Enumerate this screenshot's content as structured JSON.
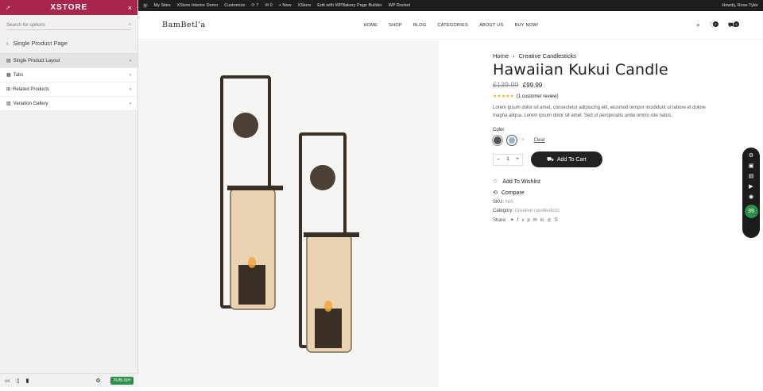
{
  "customizer": {
    "logo": "XSTORE",
    "close": "×",
    "search_placeholder": "Search for options",
    "section_title": "Single Product Page",
    "items": [
      {
        "label": "Single Product Layout",
        "icon": "layout-icon"
      },
      {
        "label": "Tabs",
        "icon": "tabs-icon"
      },
      {
        "label": "Related Products",
        "icon": "sitemap-icon"
      },
      {
        "label": "Variation Gallery",
        "icon": "gallery-icon"
      }
    ],
    "publish": "PUBLISH"
  },
  "adminbar": {
    "my_sites": "My Sites",
    "site_name": "XStore Interior Demo",
    "customize": "Customize",
    "updates": "7",
    "comments": "0",
    "new": "New",
    "xstore": "XStore",
    "edit_with": "Edit with WPBakery Page Builder",
    "wp_rocket": "WP Rocket",
    "howdy": "Howdy, Rose Tyler"
  },
  "site": {
    "brand": "BamBetl'a",
    "menu": [
      "HOME",
      "SHOP",
      "BLOG",
      "CATEGORIES",
      "ABOUT US",
      "BUY NOW!"
    ],
    "wishlist_count": "0",
    "cart_count": "0"
  },
  "product": {
    "breadcrumb": [
      "Home",
      "Creative Candlesticks"
    ],
    "title": "Hawaiian Kukui Candle",
    "old_price": "£139.99",
    "price": "£99.99",
    "rating_stars": 5,
    "reviews": "(1 customer review)",
    "description": "Lorem ipsum dolor sit amet, consectetur adipiscing elit, eiusmod tempor incididunt ut labore et dolore magna aliqua. Lorem ipsum dolor sit amet. Sed ut perspiciatis unde omnis iste natus.",
    "color_label": "Color",
    "swatch_colors": [
      "#555555",
      "#8fb7c6"
    ],
    "clear": "Clear",
    "qty": "1",
    "add_to_cart": "Add To Cart",
    "wishlist": "Add To Wishlist",
    "compare": "Compare",
    "sku_label": "SKU:",
    "sku_value": "N/A",
    "category_label": "Category:",
    "category_value": "Creative candlesticks",
    "share_label": "Share:"
  },
  "tools": {
    "counter": "39"
  }
}
